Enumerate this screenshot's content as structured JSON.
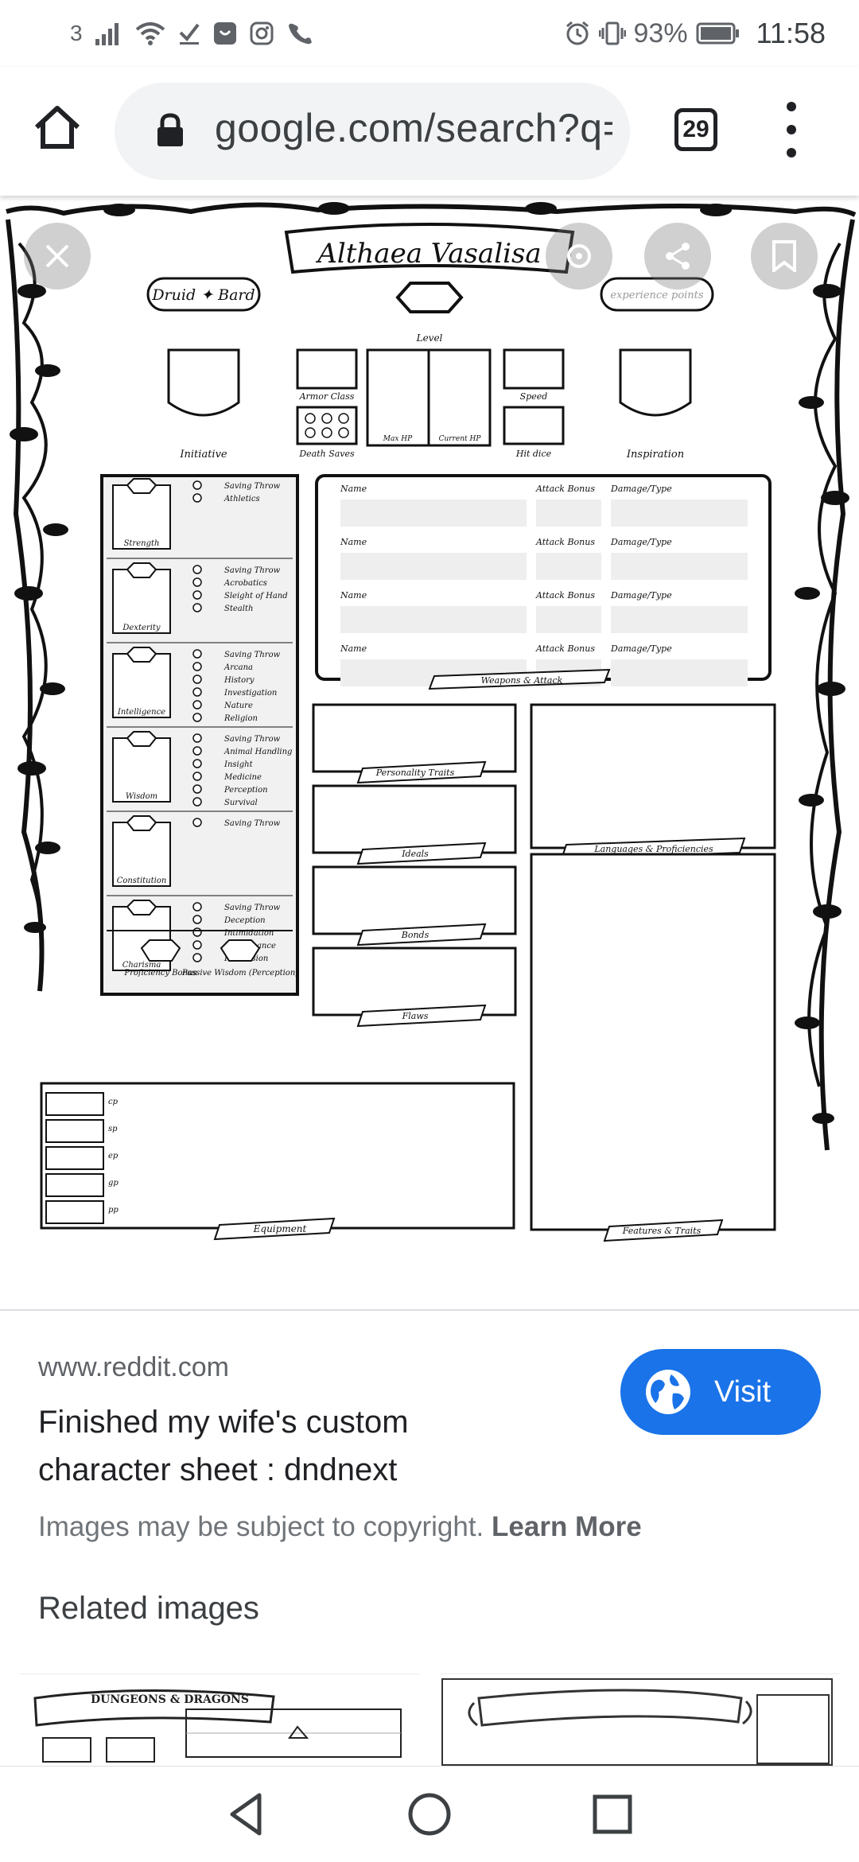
{
  "status_bar": {
    "carrier": "3",
    "battery": "93%",
    "time": "11:58",
    "icons": [
      "signal-icon",
      "wifi-icon",
      "check-icon",
      "app-icon",
      "instagram-icon",
      "phone-icon",
      "alarm-icon",
      "vibrate-icon",
      "battery-icon"
    ]
  },
  "browser": {
    "url": "google.com/search?q=",
    "tab_count": "29"
  },
  "sheet": {
    "character_name": "Althaea Vasalisa",
    "class_banner": "Druid ✦ Bard",
    "experience_placeholder": "experience points",
    "level_label": "Level",
    "initiative_label": "Initiative",
    "armor_class_label": "Armor Class",
    "death_saves_label": "Death Saves",
    "max_hp_label": "Max HP",
    "current_hp_label": "Current HP",
    "speed_label": "Speed",
    "hit_dice_label": "Hit dice",
    "inspiration_label": "Inspiration",
    "abilities": [
      {
        "name": "Strength",
        "skills": [
          "Saving Throw",
          "Athletics"
        ]
      },
      {
        "name": "Dexterity",
        "skills": [
          "Saving Throw",
          "Acrobatics",
          "Sleight of Hand",
          "Stealth"
        ]
      },
      {
        "name": "Intelligence",
        "skills": [
          "Saving Throw",
          "Arcana",
          "History",
          "Investigation",
          "Nature",
          "Religion"
        ]
      },
      {
        "name": "Wisdom",
        "skills": [
          "Saving Throw",
          "Animal Handling",
          "Insight",
          "Medicine",
          "Perception",
          "Survival"
        ]
      },
      {
        "name": "Constitution",
        "skills": [
          "Saving Throw"
        ]
      },
      {
        "name": "Charisma",
        "skills": [
          "Saving Throw",
          "Deception",
          "Intimidation",
          "Performance",
          "Persuasion"
        ]
      }
    ],
    "proficiency_label": "Proficiency Bonus",
    "passive_wisdom_label": "Passive Wisdom (Perception)",
    "weapon_headers": {
      "name": "Name",
      "attack": "Attack Bonus",
      "damage": "Damage/Type"
    },
    "weapons_banner": "Weapons & Attack",
    "personality_banner": "Personality Traits",
    "ideals_banner": "Ideals",
    "bonds_banner": "Bonds",
    "flaws_banner": "Flaws",
    "languages_banner": "Languages & Proficiencies",
    "features_banner": "Features & Traits",
    "equipment_banner": "Equipment",
    "coins": [
      "cp",
      "sp",
      "ep",
      "gp",
      "pp"
    ]
  },
  "result": {
    "source": "www.reddit.com",
    "title": "Finished my wife's custom character sheet : dndnext",
    "visit_label": "Visit",
    "copyright_text": "Images may be subject to copyright.",
    "learn_more": "Learn More"
  },
  "related": {
    "heading": "Related images",
    "thumb1_text": "DUNGEONS & DRAGONS"
  }
}
